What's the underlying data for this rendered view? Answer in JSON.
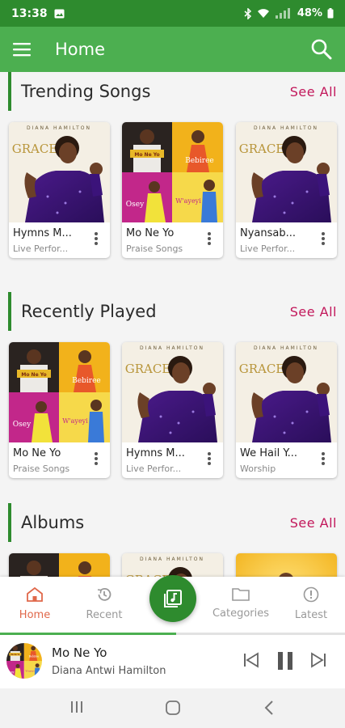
{
  "status": {
    "time": "13:38",
    "battery": "48%"
  },
  "app_bar": {
    "title": "Home"
  },
  "sections": [
    {
      "title": "Trending Songs",
      "see_all": "See All",
      "cards": [
        {
          "name": "Hymns M...",
          "sub": "Live Perfor...",
          "art": "grace"
        },
        {
          "name": "Mo Ne Yo",
          "sub": "Praise Songs",
          "art": "collage"
        },
        {
          "name": "Nyansab...",
          "sub": "Live Perfor...",
          "art": "grace"
        }
      ]
    },
    {
      "title": "Recently Played",
      "see_all": "See All",
      "cards": [
        {
          "name": "Mo Ne Yo",
          "sub": "Praise Songs",
          "art": "collage"
        },
        {
          "name": "Hymns M...",
          "sub": "Live Perfor...",
          "art": "grace"
        },
        {
          "name": "We Hail Y...",
          "sub": "Worship",
          "art": "grace"
        }
      ]
    },
    {
      "title": "Albums",
      "see_all": "See All",
      "cards": [
        {
          "name": "",
          "sub": "",
          "art": "collage"
        },
        {
          "name": "",
          "sub": "",
          "art": "grace"
        },
        {
          "name": "",
          "sub": "",
          "art": "yellow"
        }
      ]
    }
  ],
  "album_art_text": {
    "grace": "GRACE",
    "grace_header": "DIANA HAMILTON",
    "collage_top": "Mo Ne Yo",
    "collage_right": "Bebiree",
    "collage_left": "Osey",
    "collage_bottom": "W'ayeyi"
  },
  "bottom_nav": {
    "items": [
      {
        "label": "Home",
        "icon": "home-icon",
        "active": true
      },
      {
        "label": "Recent",
        "icon": "history-icon",
        "active": false
      },
      {
        "label": "Categories",
        "icon": "folder-icon",
        "active": false
      },
      {
        "label": "Latest",
        "icon": "alert-circle-icon",
        "active": false
      }
    ],
    "center_icon": "music-library-icon"
  },
  "player": {
    "title": "Mo Ne Yo",
    "artist": "Diana Antwi Hamilton",
    "progress": 0.51
  },
  "colors": {
    "status_bar": "#2e8b2e",
    "app_bar": "#4caf50",
    "accent": "#2e8b2e",
    "see_all": "#c2185b",
    "nav_active": "#e0684a"
  }
}
